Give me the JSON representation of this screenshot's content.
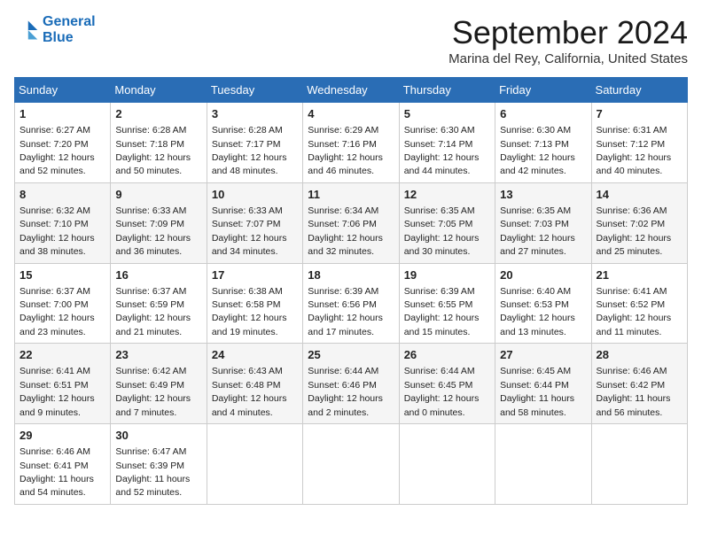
{
  "header": {
    "logo_line1": "General",
    "logo_line2": "Blue",
    "month_year": "September 2024",
    "location": "Marina del Rey, California, United States"
  },
  "days_of_week": [
    "Sunday",
    "Monday",
    "Tuesday",
    "Wednesday",
    "Thursday",
    "Friday",
    "Saturday"
  ],
  "weeks": [
    [
      {
        "day": "1",
        "sunrise": "6:27 AM",
        "sunset": "7:20 PM",
        "daylight": "12 hours and 52 minutes."
      },
      {
        "day": "2",
        "sunrise": "6:28 AM",
        "sunset": "7:18 PM",
        "daylight": "12 hours and 50 minutes."
      },
      {
        "day": "3",
        "sunrise": "6:28 AM",
        "sunset": "7:17 PM",
        "daylight": "12 hours and 48 minutes."
      },
      {
        "day": "4",
        "sunrise": "6:29 AM",
        "sunset": "7:16 PM",
        "daylight": "12 hours and 46 minutes."
      },
      {
        "day": "5",
        "sunrise": "6:30 AM",
        "sunset": "7:14 PM",
        "daylight": "12 hours and 44 minutes."
      },
      {
        "day": "6",
        "sunrise": "6:30 AM",
        "sunset": "7:13 PM",
        "daylight": "12 hours and 42 minutes."
      },
      {
        "day": "7",
        "sunrise": "6:31 AM",
        "sunset": "7:12 PM",
        "daylight": "12 hours and 40 minutes."
      }
    ],
    [
      {
        "day": "8",
        "sunrise": "6:32 AM",
        "sunset": "7:10 PM",
        "daylight": "12 hours and 38 minutes."
      },
      {
        "day": "9",
        "sunrise": "6:33 AM",
        "sunset": "7:09 PM",
        "daylight": "12 hours and 36 minutes."
      },
      {
        "day": "10",
        "sunrise": "6:33 AM",
        "sunset": "7:07 PM",
        "daylight": "12 hours and 34 minutes."
      },
      {
        "day": "11",
        "sunrise": "6:34 AM",
        "sunset": "7:06 PM",
        "daylight": "12 hours and 32 minutes."
      },
      {
        "day": "12",
        "sunrise": "6:35 AM",
        "sunset": "7:05 PM",
        "daylight": "12 hours and 30 minutes."
      },
      {
        "day": "13",
        "sunrise": "6:35 AM",
        "sunset": "7:03 PM",
        "daylight": "12 hours and 27 minutes."
      },
      {
        "day": "14",
        "sunrise": "6:36 AM",
        "sunset": "7:02 PM",
        "daylight": "12 hours and 25 minutes."
      }
    ],
    [
      {
        "day": "15",
        "sunrise": "6:37 AM",
        "sunset": "7:00 PM",
        "daylight": "12 hours and 23 minutes."
      },
      {
        "day": "16",
        "sunrise": "6:37 AM",
        "sunset": "6:59 PM",
        "daylight": "12 hours and 21 minutes."
      },
      {
        "day": "17",
        "sunrise": "6:38 AM",
        "sunset": "6:58 PM",
        "daylight": "12 hours and 19 minutes."
      },
      {
        "day": "18",
        "sunrise": "6:39 AM",
        "sunset": "6:56 PM",
        "daylight": "12 hours and 17 minutes."
      },
      {
        "day": "19",
        "sunrise": "6:39 AM",
        "sunset": "6:55 PM",
        "daylight": "12 hours and 15 minutes."
      },
      {
        "day": "20",
        "sunrise": "6:40 AM",
        "sunset": "6:53 PM",
        "daylight": "12 hours and 13 minutes."
      },
      {
        "day": "21",
        "sunrise": "6:41 AM",
        "sunset": "6:52 PM",
        "daylight": "12 hours and 11 minutes."
      }
    ],
    [
      {
        "day": "22",
        "sunrise": "6:41 AM",
        "sunset": "6:51 PM",
        "daylight": "12 hours and 9 minutes."
      },
      {
        "day": "23",
        "sunrise": "6:42 AM",
        "sunset": "6:49 PM",
        "daylight": "12 hours and 7 minutes."
      },
      {
        "day": "24",
        "sunrise": "6:43 AM",
        "sunset": "6:48 PM",
        "daylight": "12 hours and 4 minutes."
      },
      {
        "day": "25",
        "sunrise": "6:44 AM",
        "sunset": "6:46 PM",
        "daylight": "12 hours and 2 minutes."
      },
      {
        "day": "26",
        "sunrise": "6:44 AM",
        "sunset": "6:45 PM",
        "daylight": "12 hours and 0 minutes."
      },
      {
        "day": "27",
        "sunrise": "6:45 AM",
        "sunset": "6:44 PM",
        "daylight": "11 hours and 58 minutes."
      },
      {
        "day": "28",
        "sunrise": "6:46 AM",
        "sunset": "6:42 PM",
        "daylight": "11 hours and 56 minutes."
      }
    ],
    [
      {
        "day": "29",
        "sunrise": "6:46 AM",
        "sunset": "6:41 PM",
        "daylight": "11 hours and 54 minutes."
      },
      {
        "day": "30",
        "sunrise": "6:47 AM",
        "sunset": "6:39 PM",
        "daylight": "11 hours and 52 minutes."
      },
      null,
      null,
      null,
      null,
      null
    ]
  ]
}
